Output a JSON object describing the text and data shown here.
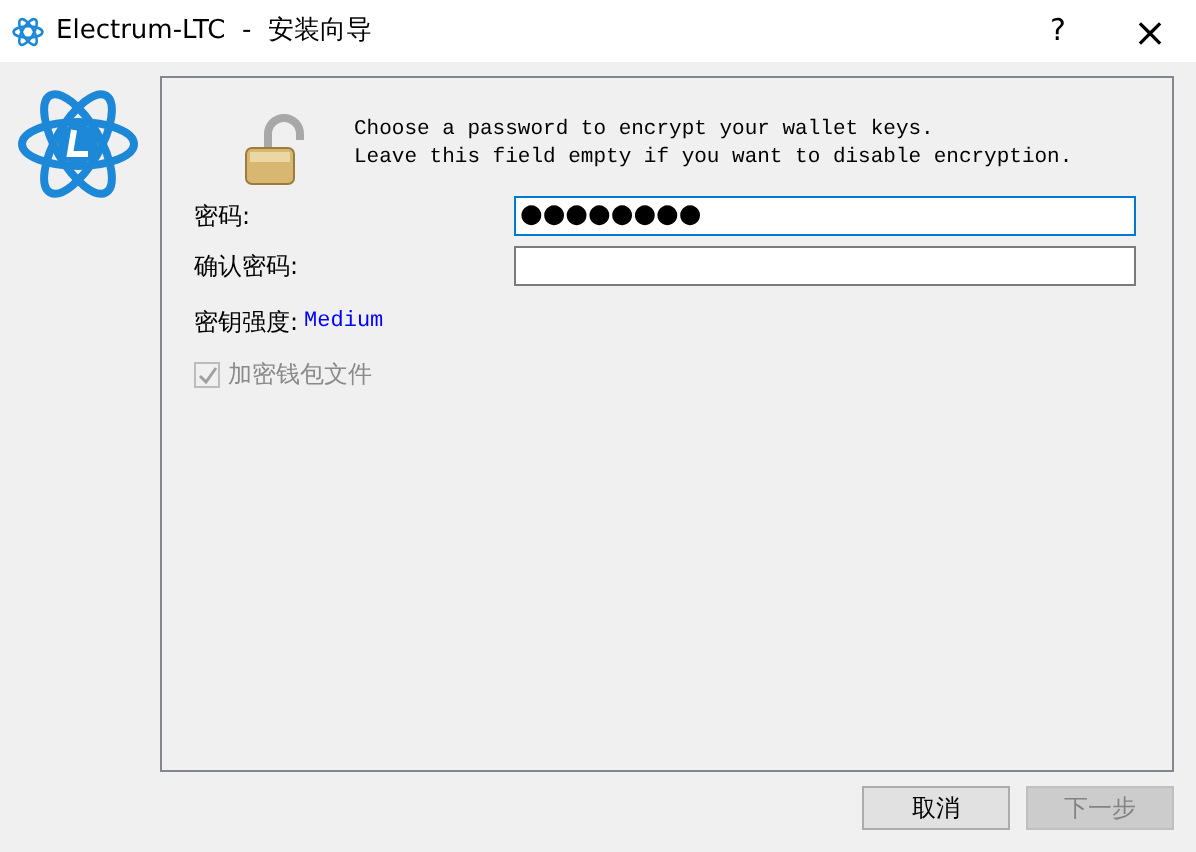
{
  "window": {
    "title": "Electrum-LTC  -  安装向导",
    "help": "?",
    "close": "×"
  },
  "message": [
    "Choose a password to encrypt your wallet keys.",
    "Leave this field empty if you want to disable encryption."
  ],
  "fields": [
    {
      "label": "密码:",
      "value": "●●●●●●●●",
      "focused": true
    },
    {
      "label": "确认密码:",
      "focused": false
    }
  ],
  "strength": {
    "label": "密钥强度:",
    "value": "Medium"
  },
  "encrypt_checkbox": {
    "label": "加密钱包文件",
    "checked": true,
    "disabled": true
  },
  "buttons": [
    {
      "label": "取消",
      "disabled": false
    },
    {
      "label": "下一步",
      "disabled": true
    }
  ]
}
